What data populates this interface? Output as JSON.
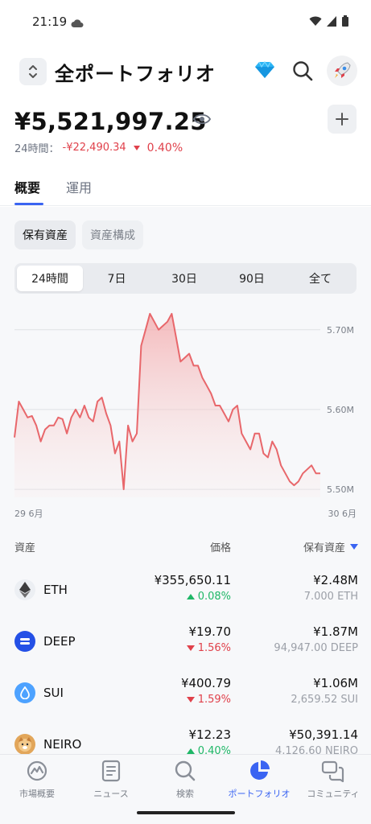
{
  "status": {
    "time": "21:19"
  },
  "header": {
    "title": "全ポートフォリオ"
  },
  "balance": {
    "amount": "¥5,521,997.25",
    "change_label": "24時間：",
    "change_value": "-¥22,490.34",
    "change_pct": "0.40%"
  },
  "tabs": [
    {
      "label": "概要"
    },
    {
      "label": "運用"
    }
  ],
  "segments": [
    {
      "label": "保有資産"
    },
    {
      "label": "資産構成"
    }
  ],
  "ranges": [
    {
      "label": "24時間"
    },
    {
      "label": "7日"
    },
    {
      "label": "30日"
    },
    {
      "label": "90日"
    },
    {
      "label": "全て"
    }
  ],
  "chart_data": {
    "type": "area",
    "x_labels": [
      "29 6月",
      "30 6月"
    ],
    "y_ticks": [
      "5.70M",
      "5.60M",
      "5.50M"
    ],
    "y_tick_values": [
      5.7,
      5.6,
      5.5
    ],
    "ylim": [
      5.49,
      5.73
    ],
    "y_unit": "M",
    "color": "#e8676b",
    "values": [
      5.565,
      5.61,
      5.6,
      5.59,
      5.592,
      5.58,
      5.56,
      5.575,
      5.58,
      5.58,
      5.59,
      5.588,
      5.57,
      5.59,
      5.6,
      5.59,
      5.605,
      5.59,
      5.585,
      5.61,
      5.615,
      5.595,
      5.58,
      5.545,
      5.56,
      5.5,
      5.58,
      5.56,
      5.57,
      5.68,
      5.7,
      5.72,
      5.71,
      5.7,
      5.705,
      5.71,
      5.72,
      5.69,
      5.66,
      5.665,
      5.67,
      5.655,
      5.655,
      5.64,
      5.63,
      5.62,
      5.605,
      5.605,
      5.595,
      5.585,
      5.6,
      5.605,
      5.57,
      5.56,
      5.55,
      5.57,
      5.57,
      5.545,
      5.54,
      5.56,
      5.55,
      5.53,
      5.52,
      5.51,
      5.505,
      5.51,
      5.52,
      5.525,
      5.53,
      5.52,
      5.52
    ]
  },
  "list": {
    "headers": {
      "asset": "資産",
      "price": "価格",
      "holding": "保有資産"
    },
    "rows": [
      {
        "symbol": "ETH",
        "price": "¥355,650.11",
        "change": "0.08%",
        "dir": "up",
        "value": "¥2.48M",
        "qty": "7.000 ETH",
        "icon": "ethereum-icon"
      },
      {
        "symbol": "DEEP",
        "price": "¥19.70",
        "change": "1.56%",
        "dir": "down",
        "value": "¥1.87M",
        "qty": "94,947.00 DEEP",
        "icon": "deep-icon"
      },
      {
        "symbol": "SUI",
        "price": "¥400.79",
        "change": "1.59%",
        "dir": "down",
        "value": "¥1.06M",
        "qty": "2,659.52 SUI",
        "icon": "sui-icon"
      },
      {
        "symbol": "NEIRO",
        "price": "¥12.23",
        "change": "0.40%",
        "dir": "up",
        "value": "¥50,391.14",
        "qty": "4,126.60 NEIRO",
        "icon": "neiro-icon"
      }
    ]
  },
  "nav": [
    {
      "label": "市場概要",
      "icon": "market-icon"
    },
    {
      "label": "ニュース",
      "icon": "news-icon"
    },
    {
      "label": "検索",
      "icon": "search-icon"
    },
    {
      "label": "ポートフォリオ",
      "icon": "portfolio-icon"
    },
    {
      "label": "コミュニティ",
      "icon": "community-icon"
    }
  ],
  "colors": {
    "accent": "#3a64f2",
    "negative": "#e0414b",
    "positive": "#1fb767"
  }
}
